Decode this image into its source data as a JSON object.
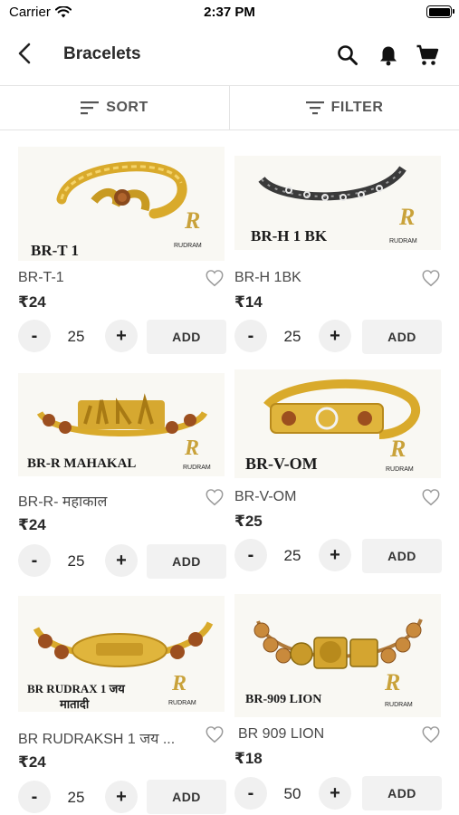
{
  "status_bar": {
    "carrier": "Carrier",
    "time": "2:37 PM"
  },
  "header": {
    "title": "Bracelets"
  },
  "toolbar": {
    "sort_label": "SORT",
    "filter_label": "FILTER"
  },
  "icons": {
    "back": "chevron-left-icon",
    "search": "search-icon",
    "notifications": "bell-icon",
    "cart": "cart-icon",
    "sort": "sort-lines-icon",
    "filter": "filter-icon",
    "wishlist": "heart-outline-icon"
  },
  "colors": {
    "accent_gold": "#c9a23a",
    "text_dark": "#2a2a2a",
    "button_bg": "#f2f2f2"
  },
  "brand_mark": {
    "text": "RUDRAM"
  },
  "products": [
    {
      "name": "BR-T-1",
      "image_label": "BR-T 1",
      "price": "₹24",
      "quantity": "25",
      "add_label": "ADD"
    },
    {
      "name": "BR-H 1BK",
      "image_label": "BR-H 1 BK",
      "price": "₹14",
      "quantity": "25",
      "add_label": "ADD"
    },
    {
      "name": "BR-R- महाकाल",
      "image_label": "BR-R MAHAKAL",
      "price": "₹24",
      "quantity": "25",
      "add_label": "ADD"
    },
    {
      "name": "BR-V-OM",
      "image_label": "BR-V-OM",
      "price": "₹25",
      "quantity": "25",
      "add_label": "ADD"
    },
    {
      "name": "BR RUDRAKSH 1 जय ...",
      "image_label": "BR RUDRAX 1 जय",
      "image_label_line2": "मातादी",
      "price": "₹24",
      "quantity": "25",
      "add_label": "ADD"
    },
    {
      "name": "BR 909 LION",
      "image_label": "BR-909 LION",
      "price": "₹18",
      "quantity": "50",
      "add_label": "ADD"
    }
  ]
}
